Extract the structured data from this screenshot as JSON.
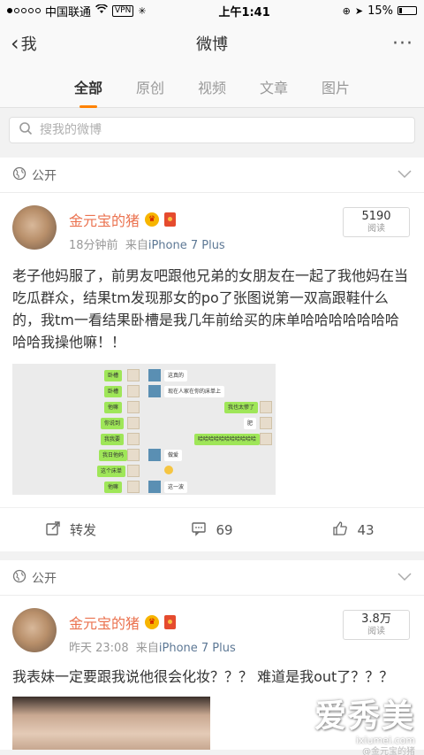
{
  "status_bar": {
    "carrier": "中国联通",
    "vpn": "VPN",
    "time": "上午1:41",
    "battery": "15%",
    "battery_fraction": 0.15
  },
  "nav": {
    "back": "我",
    "title": "微博"
  },
  "tabs": [
    {
      "label": "全部",
      "active": true
    },
    {
      "label": "原创",
      "active": false
    },
    {
      "label": "视频",
      "active": false
    },
    {
      "label": "文章",
      "active": false
    },
    {
      "label": "图片",
      "active": false
    }
  ],
  "search": {
    "placeholder": "搜我的微博"
  },
  "posts": [
    {
      "visibility": "公开",
      "user": "金元宝的猪",
      "time": "18分钟前",
      "source_prefix": "来自",
      "source": "iPhone 7 Plus",
      "reads_count": "5190",
      "reads_label": "阅读",
      "text": "老子他妈服了，前男友吧跟他兄弟的女朋友在一起了我他妈在当吃瓜群众，结果tm发现那女的po了张图说第一双高跟鞋什么的，我tm一看结果卧槽是我几年前给买的床单哈哈哈哈哈哈哈哈哈我操他嘛！！",
      "chat": {
        "green_left": [
          "卧槽",
          "卧槽",
          "他嘛",
          "你说到",
          "我我要",
          "我日他妈",
          "这个床单",
          "他嘛"
        ],
        "white_left": [
          "这真的",
          "现在人家在你的床单上",
          "做爱",
          "这一波"
        ],
        "green_right": [
          "我也太惨了",
          "哈哈哈哈哈哈哈哈哈哈哈"
        ],
        "white_right": [
          "肥"
        ]
      },
      "repost_label": "转发",
      "comments": "69",
      "likes": "43"
    },
    {
      "visibility": "公开",
      "user": "金元宝的猪",
      "time": "昨天 23:08",
      "source_prefix": "来自",
      "source": "iPhone 7 Plus",
      "reads_count": "3.8万",
      "reads_label": "阅读",
      "text": "我表妹一定要跟我说他很会化妆？？？ 难道是我out了？？？"
    }
  ],
  "watermark": {
    "brand": "爱秀美",
    "site": "ixiumei.com",
    "handle": "@金元宝的猪"
  },
  "colors": {
    "accent": "#ff8200",
    "username": "#eb7350",
    "source": "#5d7895"
  }
}
